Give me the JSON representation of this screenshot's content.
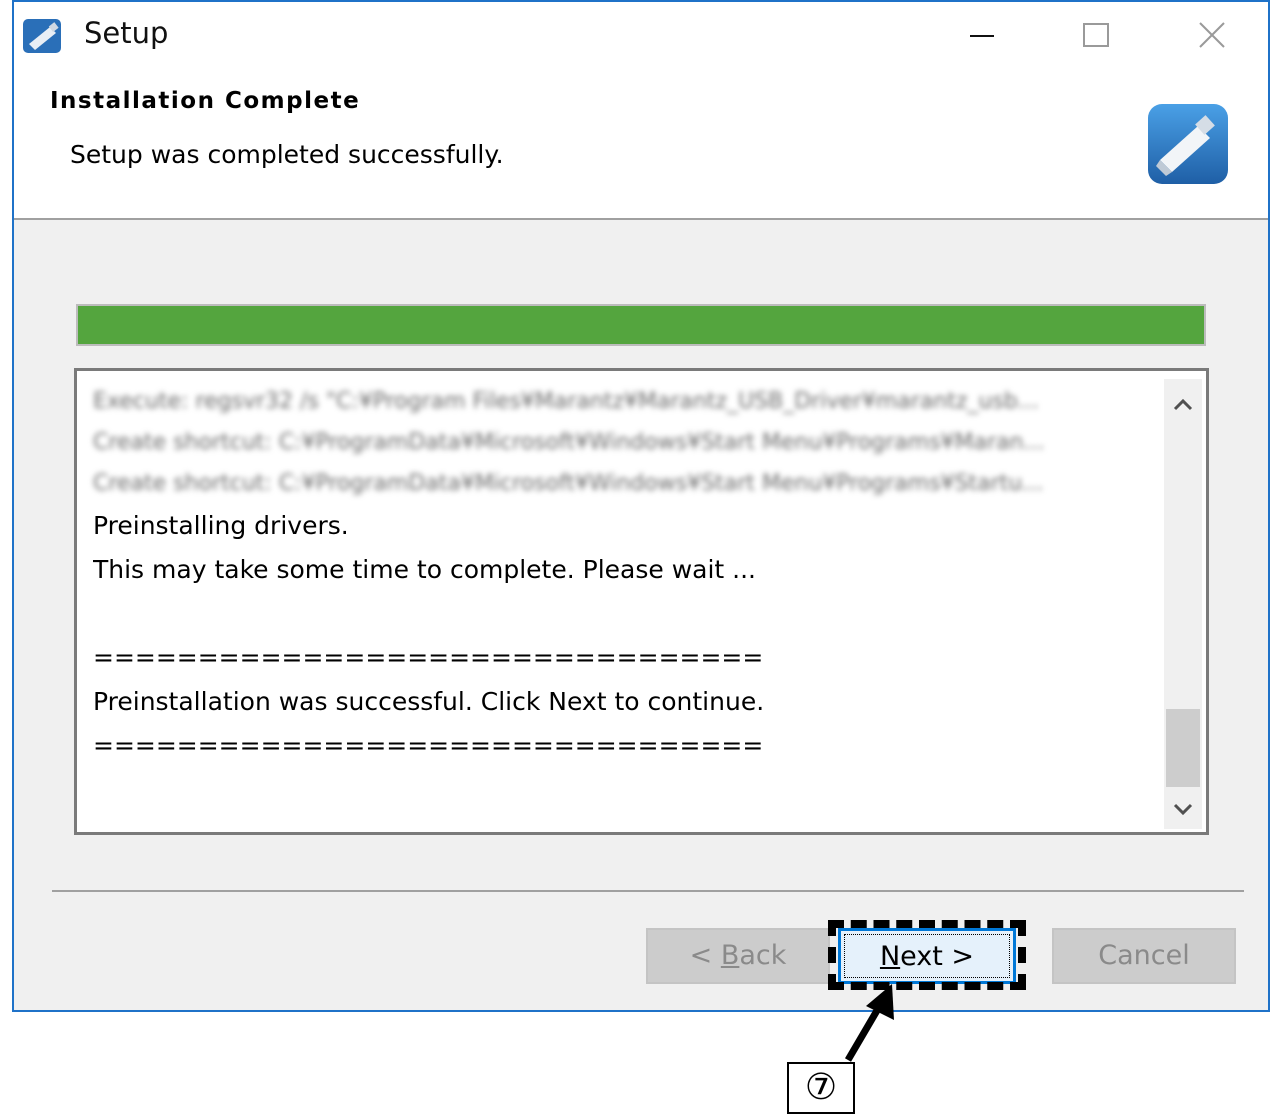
{
  "window": {
    "title": "Setup"
  },
  "header": {
    "title": "Installation Complete",
    "subtitle": "Setup was completed successfully."
  },
  "progress": {
    "value": 1.0,
    "color": "#54a53e"
  },
  "log": {
    "blurred_lines": [
      "Execute: regsvr32 /s \"C:¥Program Files¥Marantz¥Marantz_USB_Driver¥marantz_usb...",
      "Create shortcut: C:¥ProgramData¥Microsoft¥Windows¥Start Menu¥Programs¥Maran...",
      "Create shortcut: C:¥ProgramData¥Microsoft¥Windows¥Start Menu¥Programs¥Startu..."
    ],
    "line_preinstalling": "Preinstalling drivers.",
    "line_wait": "This may take some time to complete. Please wait ...",
    "line_rule1": "================================",
    "line_success": "Preinstallation was successful. Click Next to continue.",
    "line_rule2": "================================"
  },
  "buttons": {
    "back_pre": "< ",
    "back_mnemonic": "B",
    "back_post": "ack",
    "next_mnemonic": "N",
    "next_post": "ext >",
    "cancel": "Cancel"
  },
  "annotation": {
    "step": "⑦"
  },
  "icons": {
    "app": "usb-drive-icon",
    "logo": "usb-drive-logo-icon",
    "minimize": "minimize-icon",
    "maximize": "maximize-icon",
    "close": "close-icon",
    "scroll_up": "chevron-up-icon",
    "scroll_down": "chevron-down-icon"
  },
  "colors": {
    "accent": "#0078d7",
    "window_border": "#1f72c8"
  }
}
